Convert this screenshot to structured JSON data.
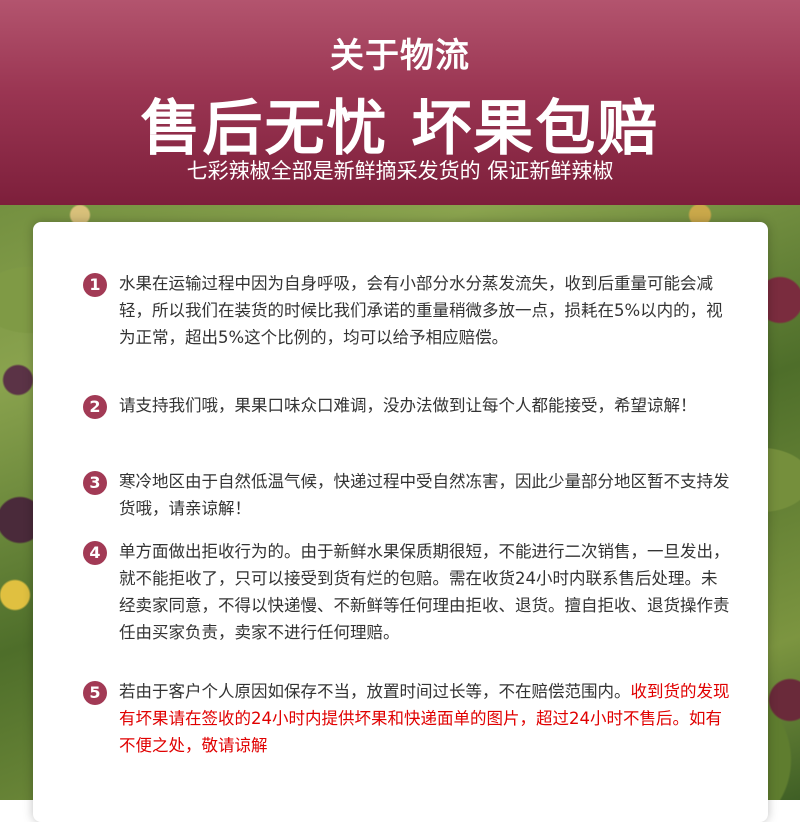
{
  "colors": {
    "header_top": "#b3546e",
    "header_bottom": "#7d1f3b",
    "badge": "#a23a55",
    "body_text": "#333333",
    "highlight_text": "#e00000"
  },
  "header": {
    "title": "关于物流",
    "headline": "售后无忧 坏果包赔",
    "subtitle": "七彩辣椒全部是新鲜摘采发货的 保证新鲜辣椒"
  },
  "items": [
    {
      "number": "1",
      "text": "水果在运输过程中因为自身呼吸，会有小部分水分蒸发流失，收到后重量可能会减轻，所以我们在装货的时候比我们承诺的重量稍微多放一点，损耗在5%以内的，视为正常，超出5%这个比例的，均可以给予相应赔偿。"
    },
    {
      "number": "2",
      "text": "请支持我们哦，果果口味众口难调，没办法做到让每个人都能接受，希望谅解！"
    },
    {
      "number": "3",
      "text": "寒冷地区由于自然低温气候，快递过程中受自然冻害，因此少量部分地区暂不支持发货哦，请亲谅解！"
    },
    {
      "number": "4",
      "text": "单方面做出拒收行为的。由于新鲜水果保质期很短，不能进行二次销售，一旦发出，就不能拒收了，只可以接受到货有烂的包赔。需在收货24小时内联系售后处理。未经卖家同意，不得以快递慢、不新鲜等任何理由拒收、退货。擅自拒收、退货操作责任由买家负责，卖家不进行任何理赔。"
    },
    {
      "number": "5",
      "text": "若由于客户个人原因如保存不当，放置时间过长等，不在赔偿范围内。",
      "highlight": "收到货的发现有坏果请在签收的24小时内提供坏果和快递面单的图片，超过24小时不售后。如有不便之处，敬请谅解"
    }
  ]
}
